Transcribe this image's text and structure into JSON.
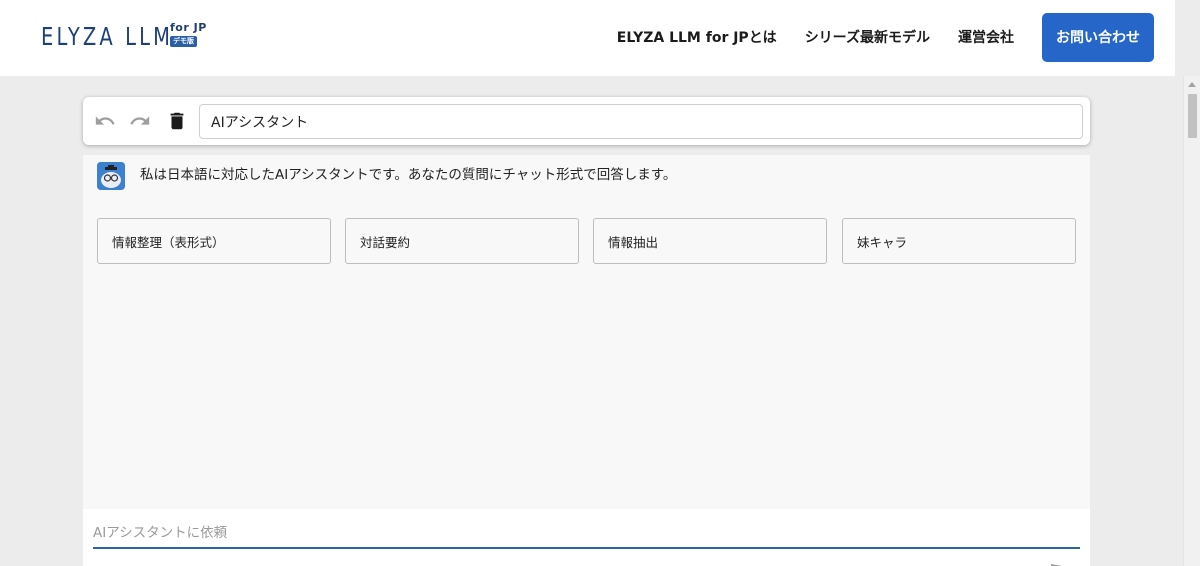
{
  "header": {
    "logo_text": "ELYZA LLM",
    "logo_sub": "for JP",
    "logo_badge": "デモ版",
    "nav": [
      {
        "label": "ELYZA LLM for JPとは"
      },
      {
        "label": "シリーズ最新モデル"
      },
      {
        "label": "運営会社"
      }
    ],
    "cta_label": "お問い合わせ",
    "colors": {
      "brand": "#1f3f78",
      "cta": "#2566c8"
    }
  },
  "toolbar": {
    "icons": [
      "undo-icon",
      "redo-icon",
      "trash-icon"
    ],
    "title_value": "AIアシスタント"
  },
  "chat": {
    "intro_message": "私は日本語に対応したAIアシスタントです。あなたの質問にチャット形式で回答します。",
    "templates": [
      {
        "label": "情報整理（表形式）"
      },
      {
        "label": "対話要約"
      },
      {
        "label": "情報抽出"
      },
      {
        "label": "妹キャラ"
      }
    ],
    "input_placeholder": "AIアシスタントに依頼",
    "input_value": ""
  }
}
